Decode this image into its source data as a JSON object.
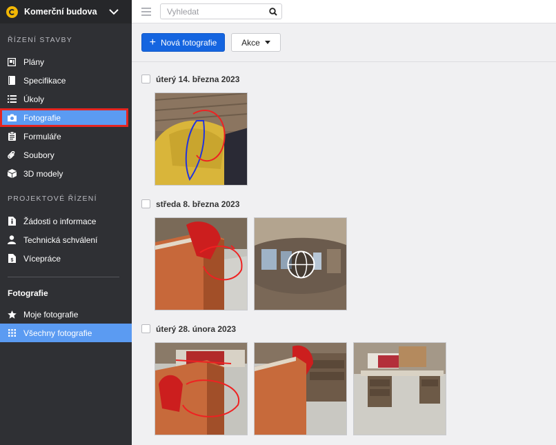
{
  "sidebar": {
    "project_name": "Komerční budova",
    "sections": {
      "construction": "ŘÍZENÍ STAVBY",
      "project": "PROJEKTOVÉ ŘÍZENÍ"
    },
    "construction_items": [
      {
        "label": "Plány",
        "icon": "plans-icon"
      },
      {
        "label": "Specifikace",
        "icon": "specification-icon"
      },
      {
        "label": "Úkoly",
        "icon": "tasks-icon"
      },
      {
        "label": "Fotografie",
        "icon": "camera-icon"
      },
      {
        "label": "Formuláře",
        "icon": "clipboard-icon"
      },
      {
        "label": "Soubory",
        "icon": "paperclip-icon"
      },
      {
        "label": "3D modely",
        "icon": "cube-icon"
      }
    ],
    "project_items": [
      {
        "label": "Žádosti o informace",
        "icon": "info-document-icon"
      },
      {
        "label": "Technická schválení",
        "icon": "user-icon"
      },
      {
        "label": "Vícepráce",
        "icon": "dollar-document-icon"
      }
    ],
    "photos_group": {
      "title": "Fotografie",
      "items": [
        {
          "label": "Moje fotografie",
          "icon": "star-icon"
        },
        {
          "label": "Všechny fotografie",
          "icon": "grid-icon"
        }
      ]
    }
  },
  "topbar": {
    "search_placeholder": "Vyhledat"
  },
  "toolbar": {
    "new_photo_label": "Nová fotografie",
    "actions_label": "Akce"
  },
  "groups": [
    {
      "date": "úterý 14. března 2023",
      "photo_count": 1
    },
    {
      "date": "středa 8. března 2023",
      "photo_count": 2
    },
    {
      "date": "úterý 28. února 2023",
      "photo_count": 3
    }
  ],
  "colors": {
    "sidebar_bg": "#2f3034",
    "active_bg": "#5b9bf2",
    "primary": "#1565e0",
    "highlight": "#e52521"
  }
}
